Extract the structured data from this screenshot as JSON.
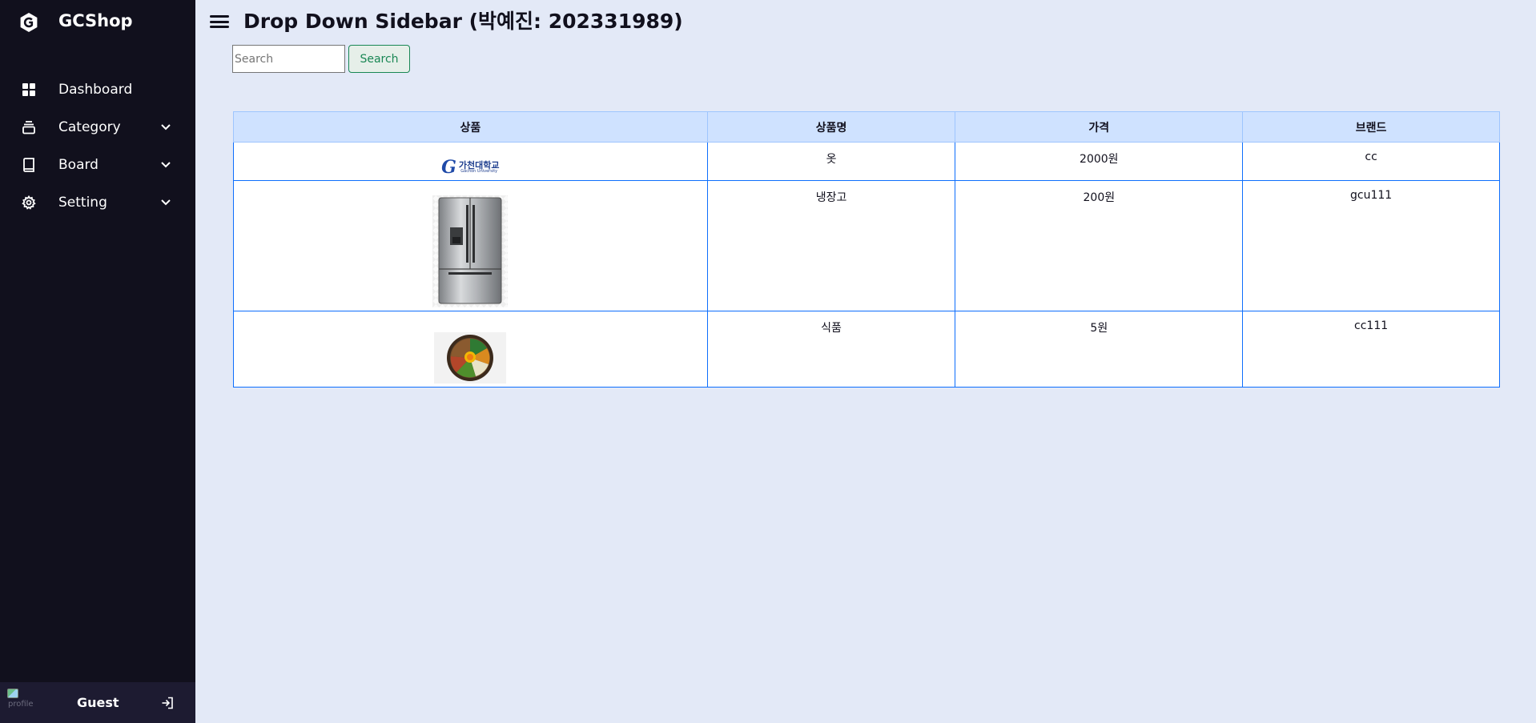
{
  "sidebar": {
    "logo_name": "GCShop",
    "logo_icon": "gcshop-logo-icon",
    "menu": [
      {
        "label": "Dashboard",
        "icon": "dashboard-grid-icon",
        "has_dropdown": false
      },
      {
        "label": "Category",
        "icon": "category-stack-icon",
        "has_dropdown": true
      },
      {
        "label": "Board",
        "icon": "book-icon",
        "has_dropdown": true
      },
      {
        "label": "Setting",
        "icon": "gear-icon",
        "has_dropdown": true
      }
    ],
    "profile": {
      "name": "Guest",
      "image_alt": "profile",
      "logout_icon": "logout-icon"
    }
  },
  "header": {
    "title": "Drop Down Sidebar (박예진: 202331989)"
  },
  "search": {
    "placeholder": "Search",
    "value": "",
    "button_label": "Search"
  },
  "table": {
    "headers": [
      "상품",
      "상품명",
      "가격",
      "브랜드"
    ],
    "rows": [
      {
        "image": "gachon-university-logo",
        "image_text_kr": "가천대학교",
        "image_text_en": "Gachon University",
        "name": "옷",
        "price": "2000원",
        "brand": "cc"
      },
      {
        "image": "refrigerator-photo",
        "name": "냉장고",
        "price": "200원",
        "brand": "gcu111"
      },
      {
        "image": "bibimbap-photo",
        "name": "식품",
        "price": "5원",
        "brand": "cc111"
      }
    ]
  },
  "colors": {
    "sidebar_bg": "#11101d",
    "profile_bg": "#1d1b31",
    "page_bg": "#e3e9f7",
    "table_header_bg": "#cfe2ff",
    "table_border": "#0d6efd",
    "search_button": "#198754"
  }
}
